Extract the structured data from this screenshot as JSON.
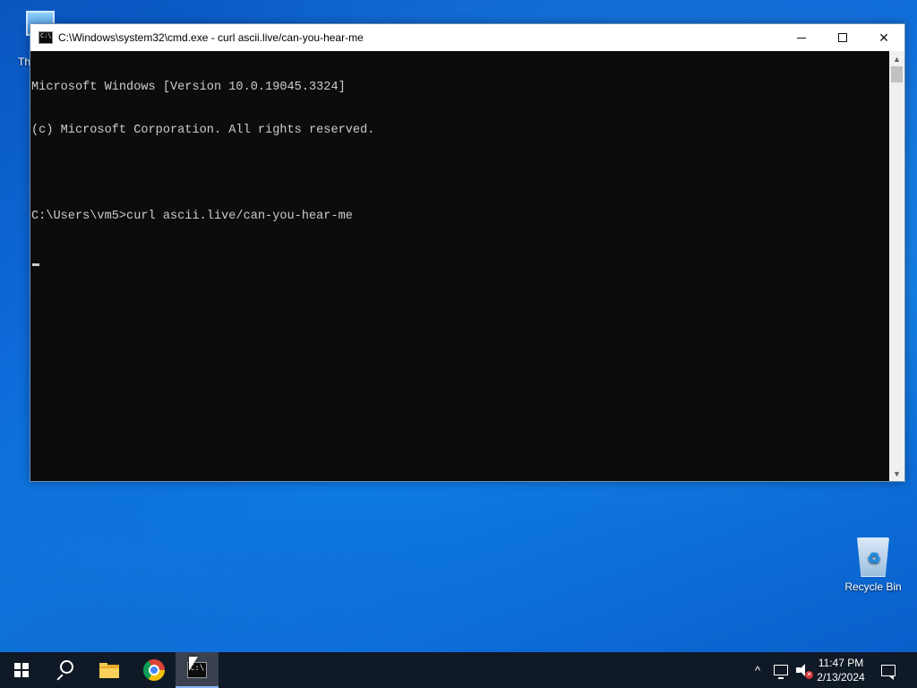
{
  "desktop": {
    "icons": [
      {
        "label": "Th"
      },
      {
        "label": "Recycle Bin"
      }
    ]
  },
  "cmd_window": {
    "title": "C:\\Windows\\system32\\cmd.exe - curl  ascii.live/can-you-hear-me",
    "controls": {
      "minimize_icon": "minimize-icon",
      "maximize_icon": "maximize-icon",
      "close_glyph": "✕"
    },
    "console_lines": [
      "Microsoft Windows [Version 10.0.19045.3324]",
      "(c) Microsoft Corporation. All rights reserved.",
      "",
      "C:\\Users\\vm5>curl ascii.live/can-you-hear-me"
    ],
    "background_color": "#0c0c0c",
    "text_color": "#cccccc"
  },
  "taskbar": {
    "apps": [
      {
        "name": "start",
        "icon": "windows-logo-icon"
      },
      {
        "name": "search",
        "icon": "search-icon"
      },
      {
        "name": "file-explorer",
        "icon": "folder-icon"
      },
      {
        "name": "chrome",
        "icon": "chrome-icon"
      },
      {
        "name": "command-prompt",
        "icon": "cmd-icon",
        "active": true
      }
    ],
    "tray": {
      "chevron": "^",
      "clock_time": "11:47 PM",
      "clock_date": "2/13/2024"
    },
    "background_color": "#101a26"
  }
}
